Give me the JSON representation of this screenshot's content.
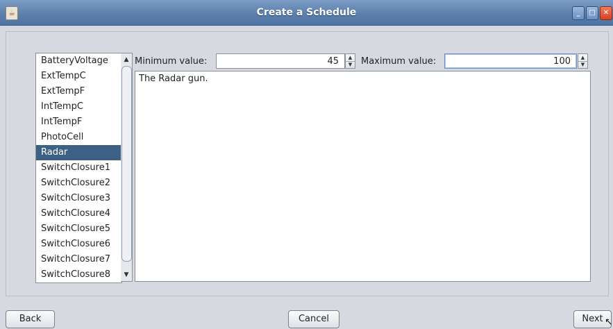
{
  "window": {
    "title": "Create a Schedule",
    "app_icon": "java-cup-icon",
    "controls": [
      "minimize-icon",
      "maximize-icon",
      "close-icon"
    ]
  },
  "sensor_list": {
    "items": [
      "BatteryVoltage",
      "ExtTempC",
      "ExtTempF",
      "IntTempC",
      "IntTempF",
      "PhotoCell",
      "Radar",
      "SwitchClosure1",
      "SwitchClosure2",
      "SwitchClosure3",
      "SwitchClosure4",
      "SwitchClosure5",
      "SwitchClosure6",
      "SwitchClosure7",
      "SwitchClosure8"
    ],
    "selected": "Radar"
  },
  "range": {
    "min_label": "Minimum value:",
    "min_value": "45",
    "max_label": "Maximum value:",
    "max_value": "100"
  },
  "description": "The Radar gun.",
  "buttons": {
    "back": "Back",
    "cancel": "Cancel",
    "next": "Next"
  },
  "colors": {
    "selection": "#3d6185",
    "titlebar": "#5d80ad",
    "background": "#d6d9df"
  }
}
